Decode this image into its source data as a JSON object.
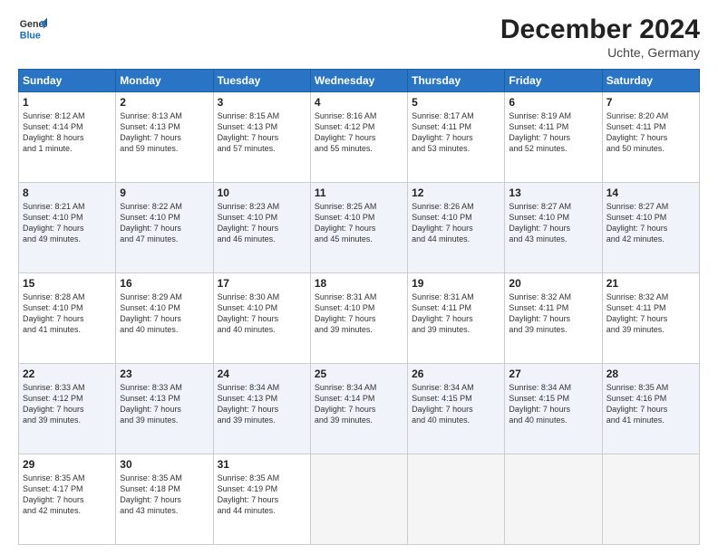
{
  "header": {
    "logo_line1": "General",
    "logo_line2": "Blue",
    "month_year": "December 2024",
    "location": "Uchte, Germany"
  },
  "weekdays": [
    "Sunday",
    "Monday",
    "Tuesday",
    "Wednesday",
    "Thursday",
    "Friday",
    "Saturday"
  ],
  "weeks": [
    [
      {
        "day": "1",
        "sunrise": "Sunrise: 8:12 AM",
        "sunset": "Sunset: 4:14 PM",
        "daylight": "Daylight: 8 hours and 1 minute."
      },
      {
        "day": "2",
        "sunrise": "Sunrise: 8:13 AM",
        "sunset": "Sunset: 4:13 PM",
        "daylight": "Daylight: 7 hours and 59 minutes."
      },
      {
        "day": "3",
        "sunrise": "Sunrise: 8:15 AM",
        "sunset": "Sunset: 4:13 PM",
        "daylight": "Daylight: 7 hours and 57 minutes."
      },
      {
        "day": "4",
        "sunrise": "Sunrise: 8:16 AM",
        "sunset": "Sunset: 4:12 PM",
        "daylight": "Daylight: 7 hours and 55 minutes."
      },
      {
        "day": "5",
        "sunrise": "Sunrise: 8:17 AM",
        "sunset": "Sunset: 4:11 PM",
        "daylight": "Daylight: 7 hours and 53 minutes."
      },
      {
        "day": "6",
        "sunrise": "Sunrise: 8:19 AM",
        "sunset": "Sunset: 4:11 PM",
        "daylight": "Daylight: 7 hours and 52 minutes."
      },
      {
        "day": "7",
        "sunrise": "Sunrise: 8:20 AM",
        "sunset": "Sunset: 4:11 PM",
        "daylight": "Daylight: 7 hours and 50 minutes."
      }
    ],
    [
      {
        "day": "8",
        "sunrise": "Sunrise: 8:21 AM",
        "sunset": "Sunset: 4:10 PM",
        "daylight": "Daylight: 7 hours and 49 minutes."
      },
      {
        "day": "9",
        "sunrise": "Sunrise: 8:22 AM",
        "sunset": "Sunset: 4:10 PM",
        "daylight": "Daylight: 7 hours and 47 minutes."
      },
      {
        "day": "10",
        "sunrise": "Sunrise: 8:23 AM",
        "sunset": "Sunset: 4:10 PM",
        "daylight": "Daylight: 7 hours and 46 minutes."
      },
      {
        "day": "11",
        "sunrise": "Sunrise: 8:25 AM",
        "sunset": "Sunset: 4:10 PM",
        "daylight": "Daylight: 7 hours and 45 minutes."
      },
      {
        "day": "12",
        "sunrise": "Sunrise: 8:26 AM",
        "sunset": "Sunset: 4:10 PM",
        "daylight": "Daylight: 7 hours and 44 minutes."
      },
      {
        "day": "13",
        "sunrise": "Sunrise: 8:27 AM",
        "sunset": "Sunset: 4:10 PM",
        "daylight": "Daylight: 7 hours and 43 minutes."
      },
      {
        "day": "14",
        "sunrise": "Sunrise: 8:27 AM",
        "sunset": "Sunset: 4:10 PM",
        "daylight": "Daylight: 7 hours and 42 minutes."
      }
    ],
    [
      {
        "day": "15",
        "sunrise": "Sunrise: 8:28 AM",
        "sunset": "Sunset: 4:10 PM",
        "daylight": "Daylight: 7 hours and 41 minutes."
      },
      {
        "day": "16",
        "sunrise": "Sunrise: 8:29 AM",
        "sunset": "Sunset: 4:10 PM",
        "daylight": "Daylight: 7 hours and 40 minutes."
      },
      {
        "day": "17",
        "sunrise": "Sunrise: 8:30 AM",
        "sunset": "Sunset: 4:10 PM",
        "daylight": "Daylight: 7 hours and 40 minutes."
      },
      {
        "day": "18",
        "sunrise": "Sunrise: 8:31 AM",
        "sunset": "Sunset: 4:10 PM",
        "daylight": "Daylight: 7 hours and 39 minutes."
      },
      {
        "day": "19",
        "sunrise": "Sunrise: 8:31 AM",
        "sunset": "Sunset: 4:11 PM",
        "daylight": "Daylight: 7 hours and 39 minutes."
      },
      {
        "day": "20",
        "sunrise": "Sunrise: 8:32 AM",
        "sunset": "Sunset: 4:11 PM",
        "daylight": "Daylight: 7 hours and 39 minutes."
      },
      {
        "day": "21",
        "sunrise": "Sunrise: 8:32 AM",
        "sunset": "Sunset: 4:11 PM",
        "daylight": "Daylight: 7 hours and 39 minutes."
      }
    ],
    [
      {
        "day": "22",
        "sunrise": "Sunrise: 8:33 AM",
        "sunset": "Sunset: 4:12 PM",
        "daylight": "Daylight: 7 hours and 39 minutes."
      },
      {
        "day": "23",
        "sunrise": "Sunrise: 8:33 AM",
        "sunset": "Sunset: 4:13 PM",
        "daylight": "Daylight: 7 hours and 39 minutes."
      },
      {
        "day": "24",
        "sunrise": "Sunrise: 8:34 AM",
        "sunset": "Sunset: 4:13 PM",
        "daylight": "Daylight: 7 hours and 39 minutes."
      },
      {
        "day": "25",
        "sunrise": "Sunrise: 8:34 AM",
        "sunset": "Sunset: 4:14 PM",
        "daylight": "Daylight: 7 hours and 39 minutes."
      },
      {
        "day": "26",
        "sunrise": "Sunrise: 8:34 AM",
        "sunset": "Sunset: 4:15 PM",
        "daylight": "Daylight: 7 hours and 40 minutes."
      },
      {
        "day": "27",
        "sunrise": "Sunrise: 8:34 AM",
        "sunset": "Sunset: 4:15 PM",
        "daylight": "Daylight: 7 hours and 40 minutes."
      },
      {
        "day": "28",
        "sunrise": "Sunrise: 8:35 AM",
        "sunset": "Sunset: 4:16 PM",
        "daylight": "Daylight: 7 hours and 41 minutes."
      }
    ],
    [
      {
        "day": "29",
        "sunrise": "Sunrise: 8:35 AM",
        "sunset": "Sunset: 4:17 PM",
        "daylight": "Daylight: 7 hours and 42 minutes."
      },
      {
        "day": "30",
        "sunrise": "Sunrise: 8:35 AM",
        "sunset": "Sunset: 4:18 PM",
        "daylight": "Daylight: 7 hours and 43 minutes."
      },
      {
        "day": "31",
        "sunrise": "Sunrise: 8:35 AM",
        "sunset": "Sunset: 4:19 PM",
        "daylight": "Daylight: 7 hours and 44 minutes."
      },
      null,
      null,
      null,
      null
    ]
  ]
}
